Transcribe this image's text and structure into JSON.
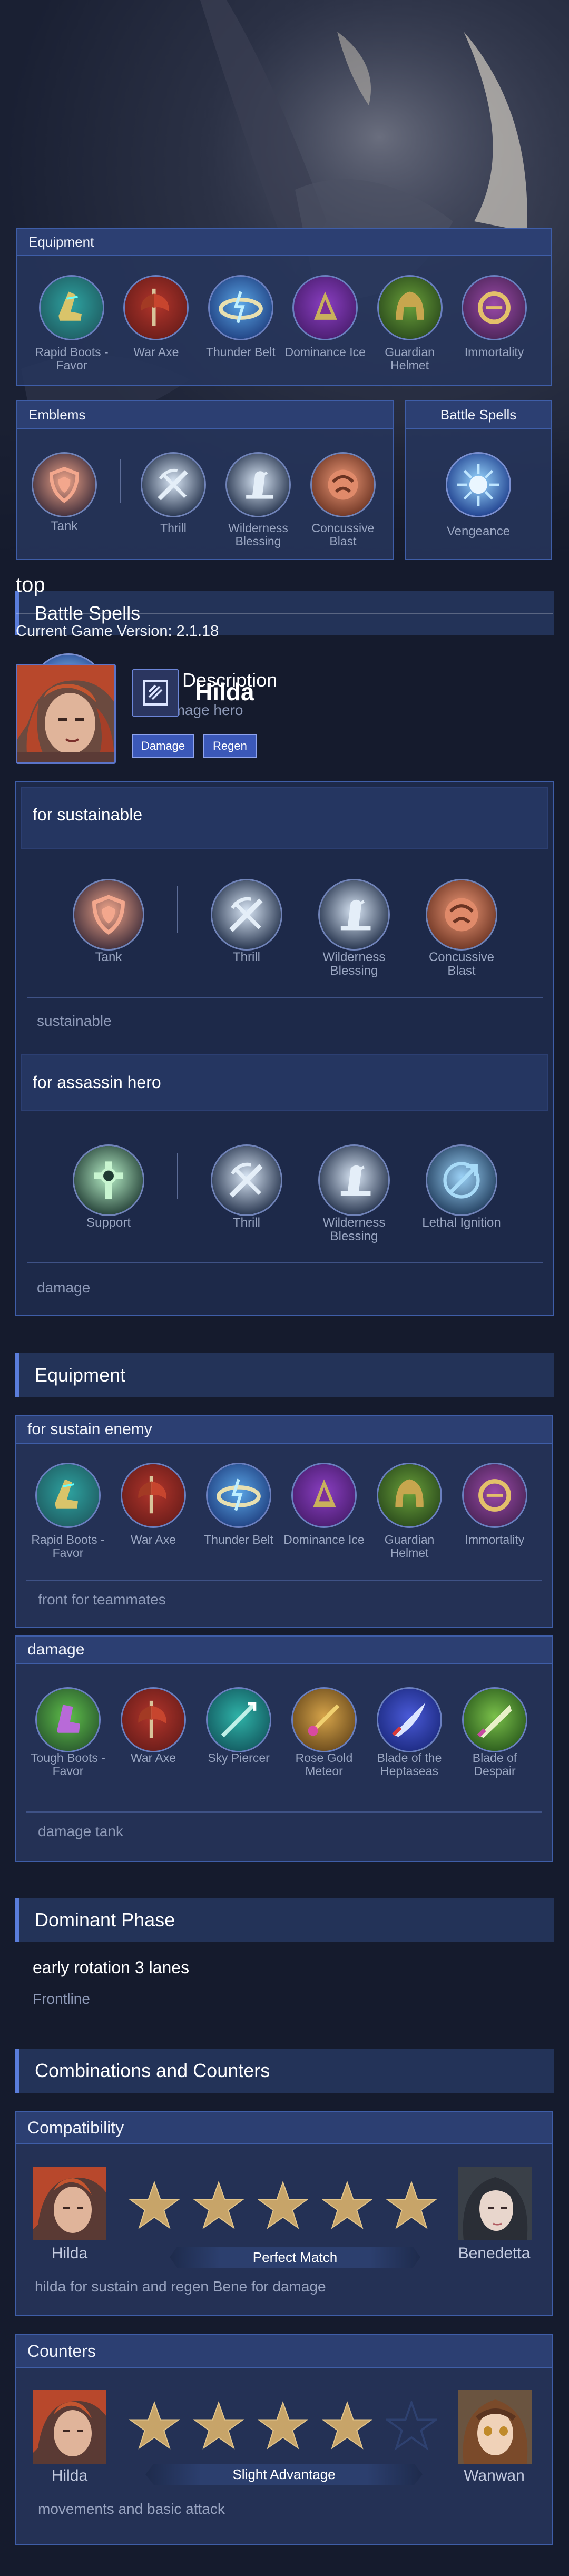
{
  "page": {
    "title": "top",
    "version": "Current Game Version: 2.1.18"
  },
  "hero": {
    "name": "Hilda",
    "tags": [
      "Damage",
      "Regen"
    ]
  },
  "equipment_panel": {
    "title": "Equipment",
    "items": [
      "Rapid Boots - Favor",
      "War Axe",
      "Thunder Belt",
      "Dominance Ice",
      "Guardian Helmet",
      "Immortality"
    ]
  },
  "emblems_panel": {
    "title": "Emblems",
    "main": "Tank",
    "talents": [
      "Thrill",
      "Wilderness Blessing",
      "Concussive Blast"
    ]
  },
  "spells_panel": {
    "title": "Battle Spells",
    "spell": "Vengeance"
  },
  "battle_spells": {
    "title": "Battle Spells",
    "spell": "Vengeance",
    "desc_title": "Spell Description",
    "desc": "for damage hero"
  },
  "emblem_builds": [
    {
      "title": "for sustainable",
      "main": "Tank",
      "talents": [
        "Thrill",
        "Wilderness Blessing",
        "Concussive Blast"
      ],
      "note": "sustainable"
    },
    {
      "title": "for assassin hero",
      "main": "Support",
      "talents": [
        "Thrill",
        "Wilderness Blessing",
        "Lethal Ignition"
      ],
      "note": "damage"
    }
  ],
  "equipment": {
    "title": "Equipment",
    "builds": [
      {
        "title": "for sustain enemy",
        "items": [
          "Rapid Boots - Favor",
          "War Axe",
          "Thunder Belt",
          "Dominance Ice",
          "Guardian Helmet",
          "Immortality"
        ],
        "note": "front for teammates"
      },
      {
        "title": "damage",
        "items": [
          "Tough Boots - Favor",
          "War Axe",
          "Sky Piercer",
          "Rose Gold Meteor",
          "Blade of the Heptaseas",
          "Blade of Despair"
        ],
        "note": "damage tank"
      }
    ]
  },
  "dominant_phase": {
    "title": "Dominant Phase",
    "heading": "early rotation 3 lanes",
    "role": "Frontline"
  },
  "combos": {
    "title": "Combinations and Counters",
    "compat": {
      "title": "Compatibility",
      "left": "Hilda",
      "right": "Benedetta",
      "label": "Perfect Match",
      "rating": 5,
      "note": "hilda for sustain and regen Bene for damage"
    },
    "counters": {
      "title": "Counters",
      "left": "Hilda",
      "right": "Wanwan",
      "label": "Slight Advantage",
      "rating": 4,
      "note": "movements and basic attack"
    }
  },
  "colors": {
    "accent": "#5a7ddb",
    "panel": "#26355c",
    "star": "#c7a469",
    "background": "#151b2d"
  }
}
